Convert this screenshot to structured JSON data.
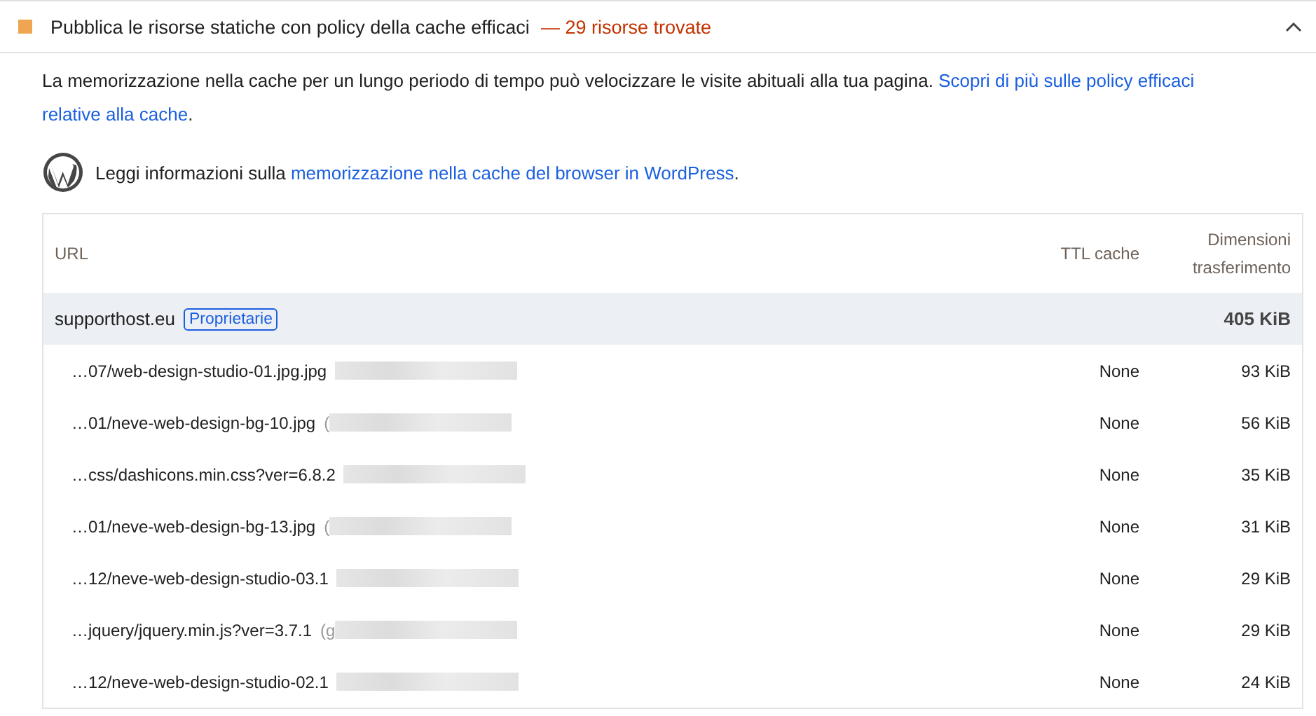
{
  "audit": {
    "title": "Pubblica le risorse statiche con policy della cache efficaci",
    "display_value": "— 29 risorse trovate",
    "expanded": true
  },
  "description": {
    "text": "La memorizzazione nella cache per un lungo periodo di tempo può velocizzare le visite abituali alla tua pagina.",
    "links": [
      "Scopri di più sulle policy efficaci",
      "relative alla cache"
    ],
    "end": "."
  },
  "stack_pack": {
    "text": "Leggi informazioni sulla",
    "link": "memorizzazione nella cache del browser in WordPress",
    "end": "."
  },
  "table": {
    "columns": [
      "URL",
      "TTL cache",
      "Dimensioni trasferimento"
    ],
    "group": {
      "name": "supporthost.eu",
      "badge": "Proprietarie",
      "size": "405 KiB"
    },
    "rows": [
      {
        "url": "…07/web-design-studio-01.jpg.jpg",
        "host": "",
        "ttl": "None",
        "size": "93 KiB"
      },
      {
        "url": "…01/neve-web-design-bg-10.jpg",
        "host": "(",
        "ttl": "None",
        "size": "56 KiB"
      },
      {
        "url": "…css/dashicons.min.css?ver=6.8.2",
        "host": "",
        "ttl": "None",
        "size": "35 KiB"
      },
      {
        "url": "…01/neve-web-design-bg-13.jpg",
        "host": "(",
        "ttl": "None",
        "size": "31 KiB"
      },
      {
        "url": "…12/neve-web-design-studio-03.1",
        "host": "",
        "ttl": "None",
        "size": "29 KiB"
      },
      {
        "url": "…jquery/jquery.min.js?ver=3.7.1",
        "host": "(g",
        "ttl": "None",
        "size": "29 KiB"
      },
      {
        "url": "…12/neve-web-design-studio-02.1",
        "host": "",
        "ttl": "None",
        "size": "24 KiB"
      }
    ]
  }
}
